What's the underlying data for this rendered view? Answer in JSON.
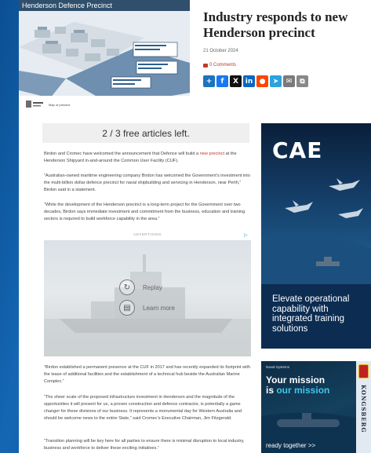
{
  "hero": {
    "title": "Henderson Defence Precinct",
    "caption": "Map of precinct"
  },
  "article": {
    "title": "Industry responds to new Henderson precinct",
    "date": "21 October 2024",
    "comments": "0 Comments"
  },
  "share": [
    {
      "icon": "plus-icon",
      "glyph": "+",
      "color": "#1e73be"
    },
    {
      "icon": "facebook-icon",
      "glyph": "f",
      "color": "#1877f2"
    },
    {
      "icon": "x-icon",
      "glyph": "X",
      "color": "#111111"
    },
    {
      "icon": "linkedin-icon",
      "glyph": "in",
      "color": "#0a66c2"
    },
    {
      "icon": "reddit-icon",
      "glyph": "●",
      "color": "#ff4500"
    },
    {
      "icon": "telegram-icon",
      "glyph": "➤",
      "color": "#2aa3df"
    },
    {
      "icon": "email-icon",
      "glyph": "✉",
      "color": "#7a7a7a"
    },
    {
      "icon": "copy-link-icon",
      "glyph": "⧉",
      "color": "#888888"
    }
  ],
  "paywall": {
    "text": "2 / 3 free articles left."
  },
  "paragraphs": {
    "p1_a": "Birdon and Cromec have welcomed the announcement that Defence will build a ",
    "p1_link": "new precinct",
    "p1_b": " at the Henderson Shipyard in-and-around the Common User Facility (CUF).",
    "p2": "“Australian-owned maritime engineering company Birdon has welcomed the Government’s investment into the multi-billion dollar defence precinct for naval shipbuilding and servicing in Henderson, near Perth,” Birdon said in a statement.",
    "p3": "“While the development of the Henderson precinct is a long-term project for the Government over two decades, Birdon says immediate investment and commitment from the business, education and training sectors is required to build workforce capability in the area.”",
    "p4": "“Birdon established a permanent presence at the CUF in 2017 and has recently expanded its footprint with the lease of additional facilities and the establishment of a technical hub beside the Australian Marine Complex.”",
    "p5": "“The sheer scale of the proposed infrastructure investment in Henderson and the magnitude of the opportunities it will present for us, a proven construction and defence contractor, is potentially a game changer for these divisions of our business. It represents a monumental day for Western Australia and should be welcome news to the entire State,” said Cromec’s Executive Chairman, Jim Fitzgerald.",
    "p6": "“Transition planning will be key here for all parties to ensure there is minimal disruption to local industry, business and workforce to deliver these exciting initiatives.”"
  },
  "ad": {
    "label": "ADVERTISING"
  },
  "video": {
    "replay": "Replay",
    "learn_more": "Learn more"
  },
  "cae_ad": {
    "logo": "CAE",
    "text": "Elevate operational capability with integrated training solutions"
  },
  "kongsberg_ad": {
    "small": "Naval Systems",
    "line1": "Your mission",
    "line2_a": "is ",
    "line2_b": "our mission",
    "cta": "ready together >>",
    "brand": "KONGSBERG"
  }
}
